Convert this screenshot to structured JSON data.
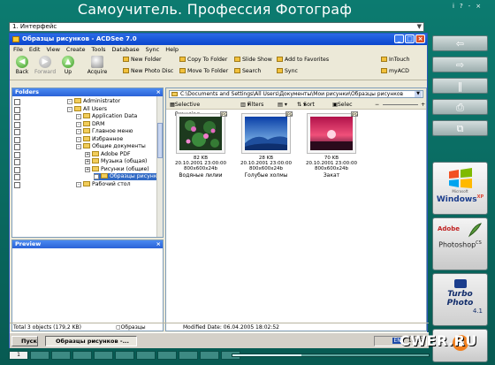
{
  "header": {
    "title": "Самоучитель. Профессия Фотограф",
    "top_icons": [
      "i",
      "?",
      "-",
      "×"
    ]
  },
  "lesson_select": {
    "value": "1. Интерфейс",
    "arrow": "▼"
  },
  "side_buttons": {
    "back": "⇦",
    "next": "⇨",
    "pause": "‖",
    "print": "⎙",
    "window": "⧉"
  },
  "logos": {
    "windows_top": "Microsoft",
    "windows": "Windows",
    "windows_sup": "XP",
    "photoshop_top": "Adobe",
    "photoshop": "Photoshop",
    "photoshop_sup": "CS",
    "turbo": "Turbo Photo",
    "turbo_ver": "4.1"
  },
  "app": {
    "title": "Образцы рисунков - ACDSee 7.0",
    "menu": [
      "File",
      "Edit",
      "View",
      "Create",
      "Tools",
      "Database",
      "Sync",
      "Help"
    ],
    "nav_buttons": [
      {
        "label": "Back",
        "glyph": "◀",
        "enabled": true
      },
      {
        "label": "Forward",
        "glyph": "▶",
        "enabled": false
      },
      {
        "label": "Up",
        "glyph": "▲",
        "enabled": true
      }
    ],
    "acquire": "Acquire",
    "commands": {
      "new_folder": "New Folder",
      "new_photo_disc": "New Photo Disc",
      "copy_to_folder": "Copy To Folder",
      "move_to_folder": "Move To Folder",
      "slide_show": "Slide Show",
      "search": "Search",
      "add_to_favorites": "Add to Favorites",
      "sync": "Sync",
      "intouch": "InTouch",
      "myacd": "myACD"
    },
    "folders_title": "Folders",
    "tree": [
      {
        "label": "Administrator",
        "level": 0
      },
      {
        "label": "All Users",
        "level": 0
      },
      {
        "label": "Application Data",
        "level": 1
      },
      {
        "label": "DRM",
        "level": 1
      },
      {
        "label": "Главное меню",
        "level": 1
      },
      {
        "label": "Избранное",
        "level": 1
      },
      {
        "label": "Общие документы",
        "level": 1
      },
      {
        "label": "Adobe PDF",
        "level": 2
      },
      {
        "label": "Музыка (общая)",
        "level": 2
      },
      {
        "label": "Рисунки (общие)",
        "level": 2
      },
      {
        "label": "Образцы рисунков",
        "level": 3
      },
      {
        "label": "Рабочий стол",
        "level": 1
      }
    ],
    "preview_title": "Preview",
    "path": "C:\\Documents and Settings\\All Users\\Документы\\Мои рисунки\\Образцы рисунков",
    "viewbar": {
      "selective": "Selective Browsing",
      "filters": "Filters",
      "sort": "Sort",
      "select": "Selec"
    },
    "thumbnails": [
      {
        "name": "Водяные лилии",
        "size": "82 KB",
        "date": "20.10.2001 23:00:00",
        "dims": "800x600x24b"
      },
      {
        "name": "Голубые холмы",
        "size": "28 KB",
        "date": "20.10.2001 23:00:00",
        "dims": "800x600x24b"
      },
      {
        "name": "Закат",
        "size": "70 KB",
        "date": "20.10.2001 23:00:00",
        "dims": "800x600x24b"
      }
    ],
    "status": {
      "total": "Total 3 objects  (179,2 KB)",
      "folder": "Образцы рисунков",
      "modified": "Modified Date: 06.04.2005 18:02:52"
    },
    "taskbar": {
      "start": "Пуск",
      "item": "Образцы рисунков -...",
      "lang": "EN",
      "clock": "18:02"
    }
  },
  "bottom": {
    "pages": [
      "1",
      "",
      "",
      "",
      "",
      "",
      "",
      "",
      "",
      "",
      ""
    ],
    "progress": 0.35
  },
  "watermark": "CWER.RU"
}
